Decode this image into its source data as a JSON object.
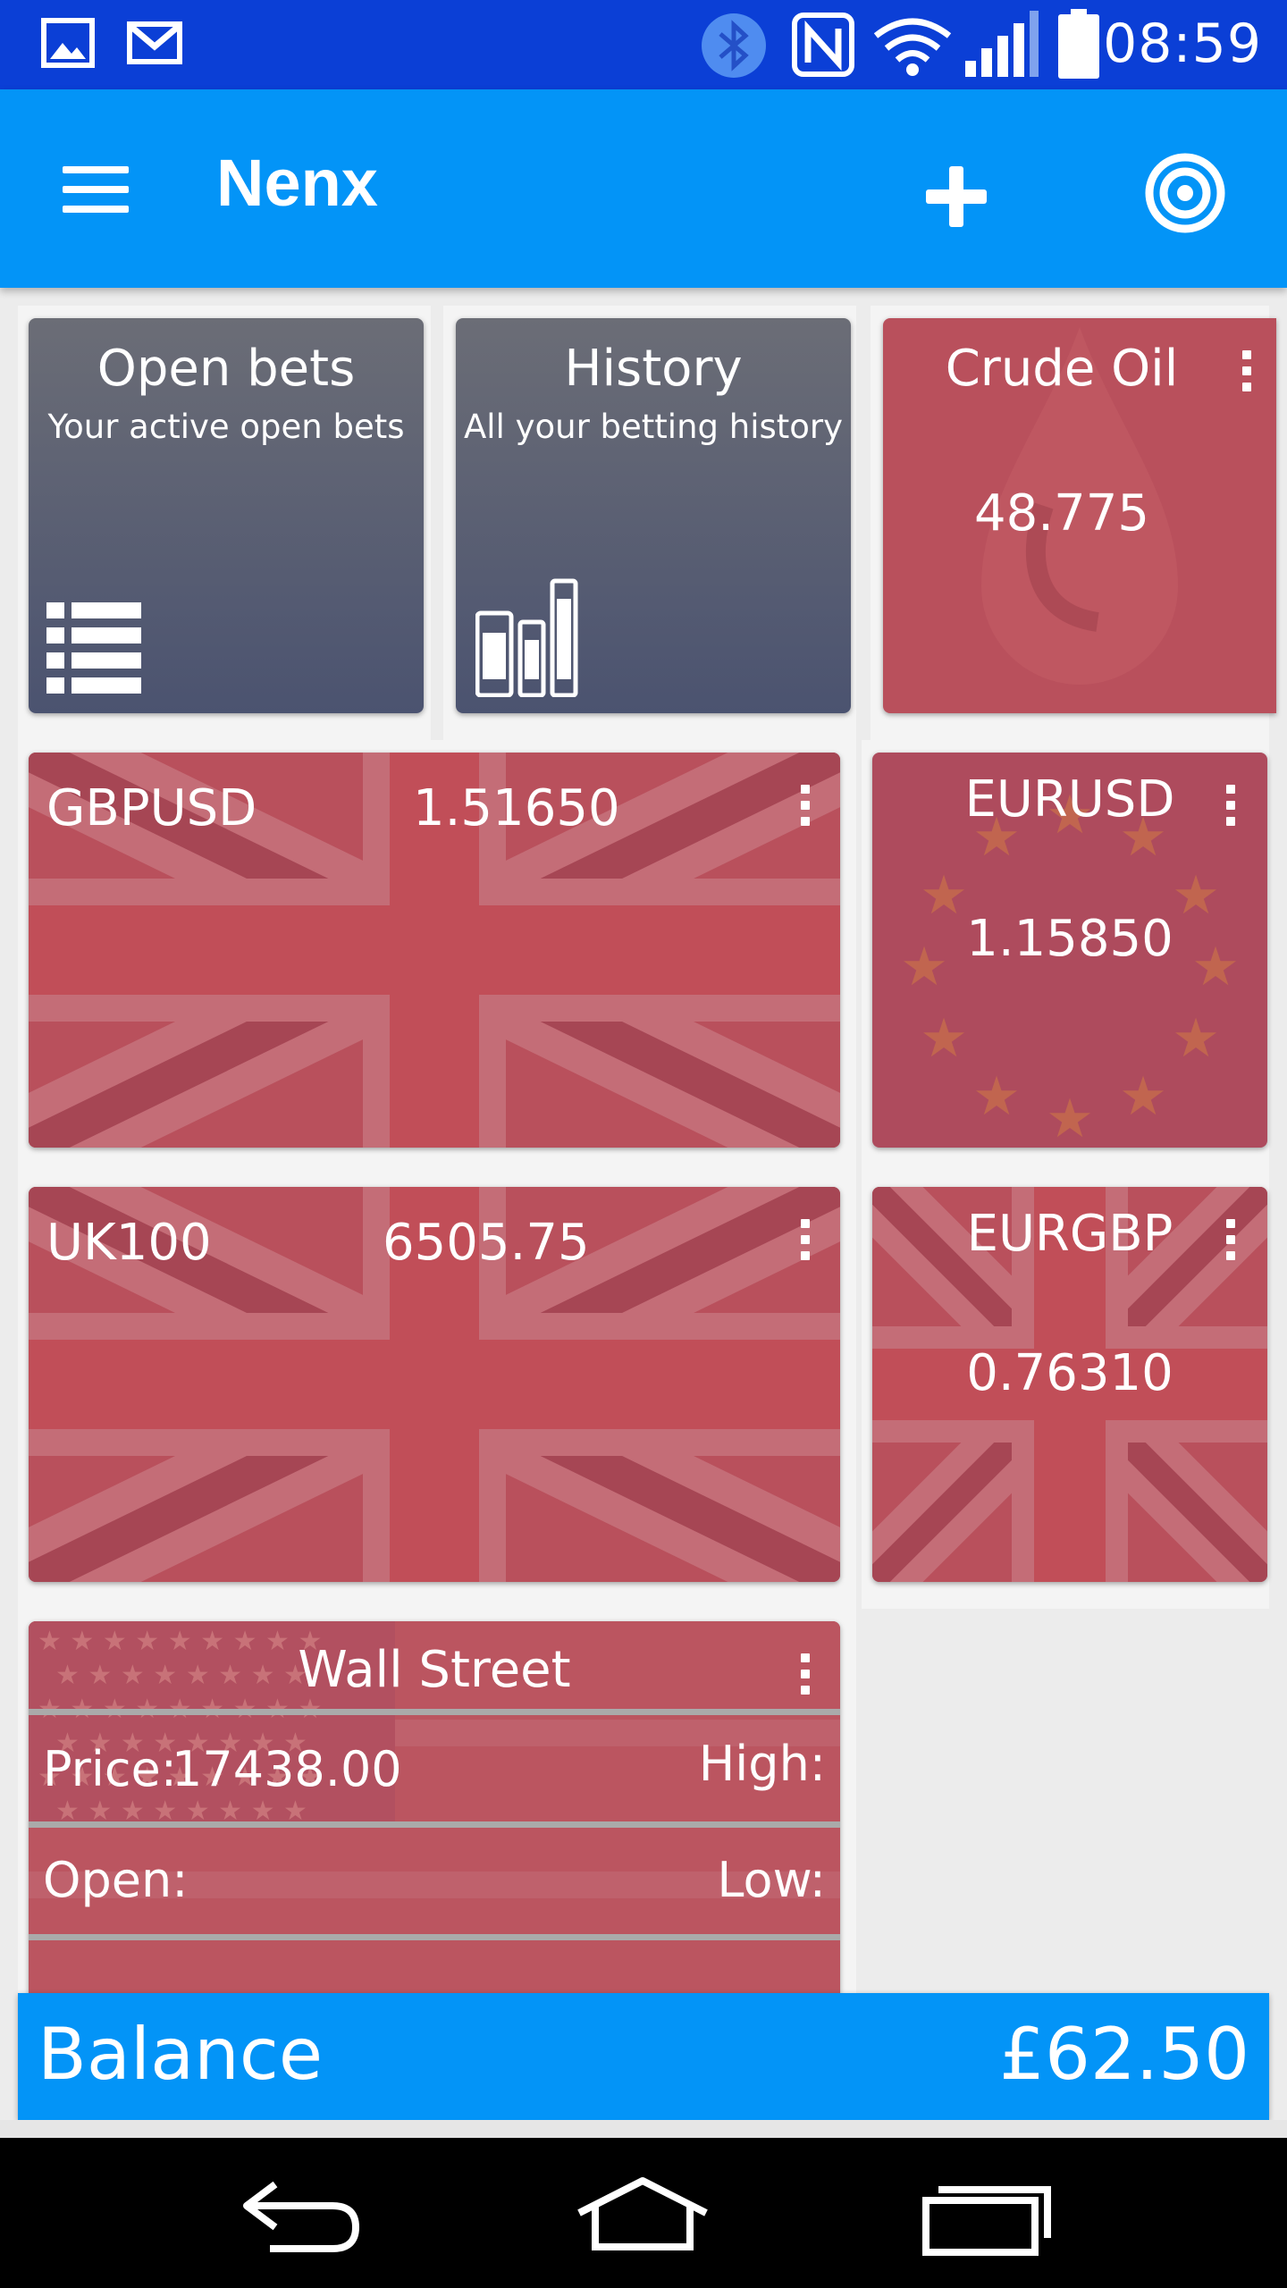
{
  "status_bar": {
    "time": "08:59",
    "icons": [
      "image-icon",
      "gmail-icon",
      "bluetooth-icon",
      "nfc-icon",
      "wifi-icon",
      "signal-icon",
      "battery-icon"
    ]
  },
  "app_bar": {
    "title": "Nenx",
    "icons": [
      "menu-icon",
      "plus-icon",
      "target-icon"
    ]
  },
  "tiles": {
    "open_bets": {
      "title": "Open bets",
      "subtitle": "Your active open bets",
      "icon": "list-icon"
    },
    "history": {
      "title": "History",
      "subtitle": "All your betting history",
      "icon": "books-icon"
    },
    "crude_oil": {
      "name": "Crude Oil",
      "price": "48.775",
      "icon": "oil-drop-icon"
    },
    "gbpusd": {
      "name": "GBPUSD",
      "price": "1.51650"
    },
    "eurusd": {
      "name": "EURUSD",
      "price": "1.15850"
    },
    "uk100": {
      "name": "UK100",
      "price": "6505.75"
    },
    "eurgbp": {
      "name": "EURGBP",
      "price": "0.76310"
    },
    "wall_street": {
      "name": "Wall Street",
      "price_label": "Price:",
      "price": "17438.00",
      "high_label": "High:",
      "open_label": "Open:",
      "low_label": "Low:"
    }
  },
  "balance": {
    "label": "Balance",
    "value": "£62.50"
  },
  "nav_bar": {
    "icons": [
      "back-icon",
      "home-icon",
      "recents-icon"
    ]
  },
  "colors": {
    "status_bar": "#0b3fd6",
    "app_bar": "#0394f7",
    "tile_red": "#b9505c",
    "tile_gray": "#5a5f72"
  }
}
